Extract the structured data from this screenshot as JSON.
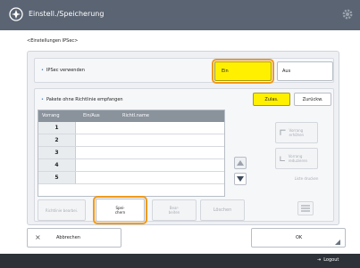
{
  "header": {
    "title": "Einstell./Speicherung",
    "title_icon": "settings-register-icon",
    "gear_icon": "gear-icon"
  },
  "breadcrumb": "<Einstellungen IPSec>",
  "ipsec": {
    "label": "IPSec verwenden",
    "on_label": "Ein",
    "off_label": "Aus",
    "selected": "Ein"
  },
  "packets": {
    "label": "Pakete ohne Richtlinie empfangen",
    "allow_label": "Zulas.",
    "block_label": "Zurückw.",
    "selected": "Zulas."
  },
  "policy_table": {
    "headers": [
      "Vorrang",
      "Ein/Aus",
      "Richtl.name"
    ],
    "rows": [
      {
        "priority": "1"
      },
      {
        "priority": "2"
      },
      {
        "priority": "3"
      },
      {
        "priority": "4"
      },
      {
        "priority": "5"
      }
    ]
  },
  "side_buttons": {
    "priority_up": "Vorrang erhöhen",
    "priority_down": "Vorrang reduzieren",
    "details": "Liste drucken"
  },
  "actions": {
    "policy_edit": "Richtlinie bearbei.",
    "register": "Spei-\nchern",
    "edit": "Bear-\nbeiten",
    "delete": "Löschen"
  },
  "footer": {
    "cancel": "Abbrechen",
    "ok": "OK",
    "logout": "Logout"
  },
  "colors": {
    "selected": "#fff000",
    "highlight": "#f19a1a",
    "titlebar": "#5a6472"
  }
}
